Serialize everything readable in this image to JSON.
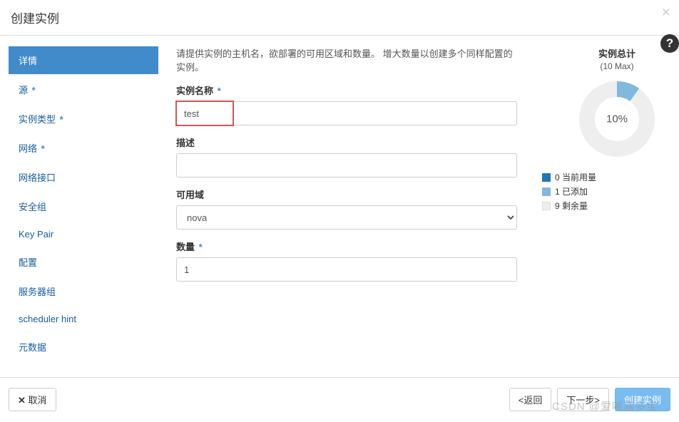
{
  "header": {
    "title": "创建实例"
  },
  "sidebar": {
    "items": [
      {
        "label": "详情",
        "required": false,
        "active": true
      },
      {
        "label": "源",
        "required": true
      },
      {
        "label": "实例类型",
        "required": true
      },
      {
        "label": "网络",
        "required": true
      },
      {
        "label": "网络接口",
        "required": false
      },
      {
        "label": "安全组",
        "required": false
      },
      {
        "label": "Key Pair",
        "required": false
      },
      {
        "label": "配置",
        "required": false
      },
      {
        "label": "服务器组",
        "required": false
      },
      {
        "label": "scheduler hint",
        "required": false
      },
      {
        "label": "元数据",
        "required": false
      }
    ]
  },
  "main": {
    "description": "请提供实例的主机名，欲部署的可用区域和数量。 增大数量以创建多个同样配置的实例。",
    "name_label": "实例名称",
    "name_value": "test",
    "desc_label": "描述",
    "desc_value": "",
    "zone_label": "可用域",
    "zone_value": "nova",
    "count_label": "数量",
    "count_value": "1"
  },
  "totals": {
    "label": "实例总计",
    "max_text": "(10 Max)",
    "percent_text": "10%",
    "legend": {
      "current": "0 当前用量",
      "added": "1 已添加",
      "remaining": "9 剩余量"
    }
  },
  "chart_data": {
    "type": "pie",
    "title": "实例总计",
    "max": 10,
    "series": [
      {
        "name": "当前用量",
        "value": 0,
        "color": "#1f77b4"
      },
      {
        "name": "已添加",
        "value": 1,
        "color": "#81b8df"
      },
      {
        "name": "剩余量",
        "value": 9,
        "color": "#eeeeee"
      }
    ],
    "percent": 10
  },
  "footer": {
    "cancel": "取消",
    "back": "<返回",
    "next": "下一步>",
    "create": "创建实例"
  },
  "watermark": "CSDN @爱喝嘉多宝"
}
